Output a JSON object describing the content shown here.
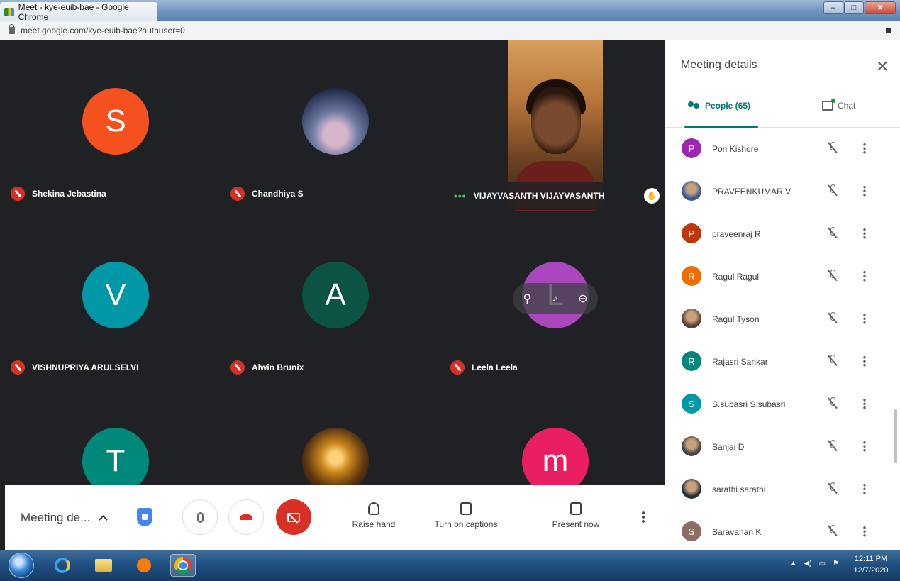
{
  "browser": {
    "tab_title": "Meet - kye-euib-bae - Google Chrome",
    "url": "meet.google.com/kye-euib-bae?authuser=0"
  },
  "tiles": [
    {
      "name": "Shekina Jebastina",
      "initial": "S",
      "color": "#f4511e",
      "type": "initial"
    },
    {
      "name": "Chandhiya S",
      "initial": "",
      "color": "#3b4a6e",
      "type": "photo-sunset"
    },
    {
      "name": "VIJAYVASANTH VIJAYVASANTH",
      "type": "video"
    },
    {
      "name": "VISHNUPRIYA ARULSELVI",
      "initial": "V",
      "color": "#0097a7",
      "type": "initial"
    },
    {
      "name": "Alwin Brunix",
      "initial": "A",
      "color": "#0b5345",
      "type": "initial"
    },
    {
      "name": "Leela Leela",
      "initial": "L",
      "color": "#ab47bc",
      "type": "initial"
    },
    {
      "name": "",
      "initial": "T",
      "color": "#00897b",
      "type": "initial"
    },
    {
      "name": "",
      "initial": "",
      "color": "#8a5a1a",
      "type": "photo-glow"
    },
    {
      "name": "",
      "initial": "m",
      "color": "#e91e63",
      "type": "initial"
    }
  ],
  "controls": {
    "meeting_details_label": "Meeting de...",
    "raise_hand_label": "Raise hand",
    "captions_label": "Turn on captions",
    "present_label": "Present now"
  },
  "panel": {
    "title": "Meeting details",
    "people_tab_label": "People (65)",
    "chat_tab_label": "Chat",
    "people": [
      {
        "name": "Pon Kishore",
        "initial": "P",
        "color": "#9c27b0"
      },
      {
        "name": "PRAVEENKUMAR.V",
        "initial": "",
        "color": "#3b5998",
        "photo": true
      },
      {
        "name": "praveenraj R",
        "initial": "P",
        "color": "#bf360c"
      },
      {
        "name": "Ragul Ragul",
        "initial": "R",
        "color": "#ef6c00"
      },
      {
        "name": "Ragul Tyson",
        "initial": "",
        "color": "#5d4037",
        "photo": true
      },
      {
        "name": "Rajasri Sankar",
        "initial": "R",
        "color": "#00897b"
      },
      {
        "name": "S.subasri S.subasri",
        "initial": "S",
        "color": "#0097a7"
      },
      {
        "name": "Sanjai D",
        "initial": "",
        "color": "#424242",
        "photo": true
      },
      {
        "name": "sarathi sarathi",
        "initial": "",
        "color": "#263238",
        "photo": true
      },
      {
        "name": "Saravanan K",
        "initial": "S",
        "color": "#8d6e63"
      }
    ]
  },
  "taskbar": {
    "time": "12:11 PM",
    "date": "12/7/2020"
  },
  "colors": {
    "grid_bg": "#202124",
    "accent_teal": "#00796b",
    "mute_red": "#d93025"
  }
}
